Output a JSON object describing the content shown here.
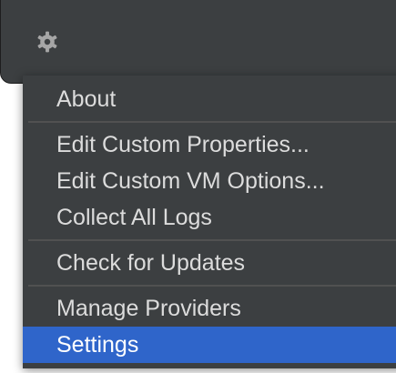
{
  "toolbar": {
    "settings_icon": "gear-icon"
  },
  "menu": {
    "items": [
      {
        "label": "About"
      },
      {
        "label": "Edit Custom Properties..."
      },
      {
        "label": "Edit Custom VM Options..."
      },
      {
        "label": "Collect All Logs"
      },
      {
        "label": "Check for Updates"
      },
      {
        "label": "Manage Providers"
      },
      {
        "label": "Settings",
        "selected": true
      }
    ]
  },
  "colors": {
    "panel_bg": "#3c3f41",
    "text": "#dcdcdc",
    "selection": "#2f65ca",
    "separator": "#515151",
    "icon": "#a6a6a6"
  }
}
